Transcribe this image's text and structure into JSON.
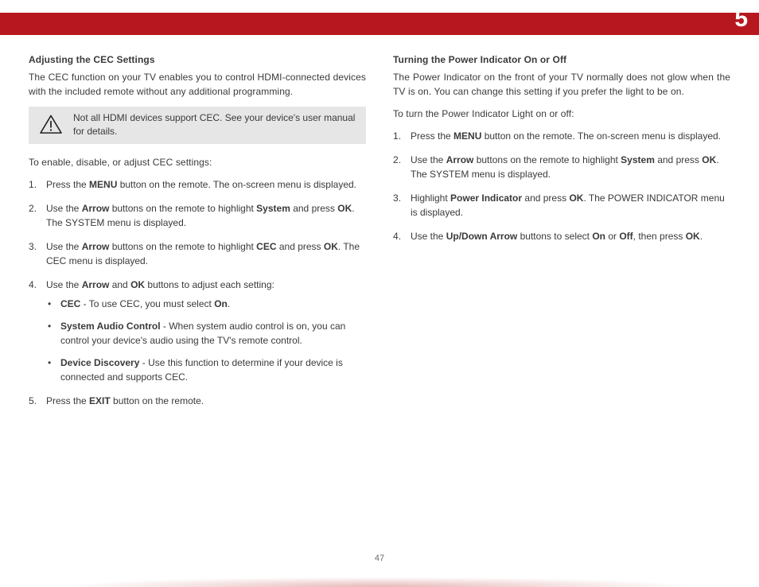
{
  "chapter": "5",
  "pageNumber": "47",
  "left": {
    "title": "Adjusting the CEC Settings",
    "intro": "The CEC function on your TV enables you to control HDMI-connected devices with the included remote without any additional programming.",
    "note": "Not all HDMI devices support CEC. See your device's user manual for details.",
    "lead": "To enable, disable, or adjust CEC settings:",
    "s1a": "Press the ",
    "s1b": "MENU",
    "s1c": " button on the remote. The on-screen menu is displayed.",
    "s2a": "Use the ",
    "s2b": "Arrow",
    "s2c": " buttons on the remote to highlight ",
    "s2d": "System",
    "s2e": " and press ",
    "s2f": "OK",
    "s2g": ". The SYSTEM menu is displayed.",
    "s3a": "Use the ",
    "s3b": "Arrow",
    "s3c": " buttons on the remote to highlight ",
    "s3d": "CEC",
    "s3e": " and press ",
    "s3f": "OK",
    "s3g": ". The CEC menu is displayed.",
    "s4a": "Use the ",
    "s4b": "Arrow",
    "s4c": " and ",
    "s4d": "OK",
    "s4e": " buttons to adjust each setting:",
    "b1a": "CEC",
    "b1b": " - To use CEC, you must select ",
    "b1c": "On",
    "b1d": ".",
    "b2a": "System Audio Control",
    "b2b": " - When system audio control is on, you can control your device's audio using the TV's remote control.",
    "b3a": "Device Discovery",
    "b3b": " - Use this function to determine if your device is connected and supports CEC.",
    "s5a": "Press the ",
    "s5b": "EXIT",
    "s5c": " button on the remote."
  },
  "right": {
    "title": "Turning the Power Indicator On or Off",
    "intro": "The Power Indicator on the front of your TV normally does not glow when the TV is on. You can change this setting if you prefer the light to be on.",
    "lead": "To turn the Power Indicator Light on or off:",
    "s1a": "Press the ",
    "s1b": "MENU",
    "s1c": " button on the remote. The on-screen menu is displayed.",
    "s2a": "Use the ",
    "s2b": "Arrow",
    "s2c": " buttons on the remote to highlight ",
    "s2d": "System",
    "s2e": " and press ",
    "s2f": "OK",
    "s2g": ". The SYSTEM menu is displayed.",
    "s3a": "Highlight ",
    "s3b": "Power Indicator",
    "s3c": " and press ",
    "s3d": "OK",
    "s3e": ". The POWER INDICATOR menu is displayed.",
    "s4a": "Use the ",
    "s4b": "Up/Down Arrow",
    "s4c": " buttons to select ",
    "s4d": "On",
    "s4e": " or ",
    "s4f": "Off",
    "s4g": ", then press ",
    "s4h": "OK",
    "s4i": "."
  }
}
